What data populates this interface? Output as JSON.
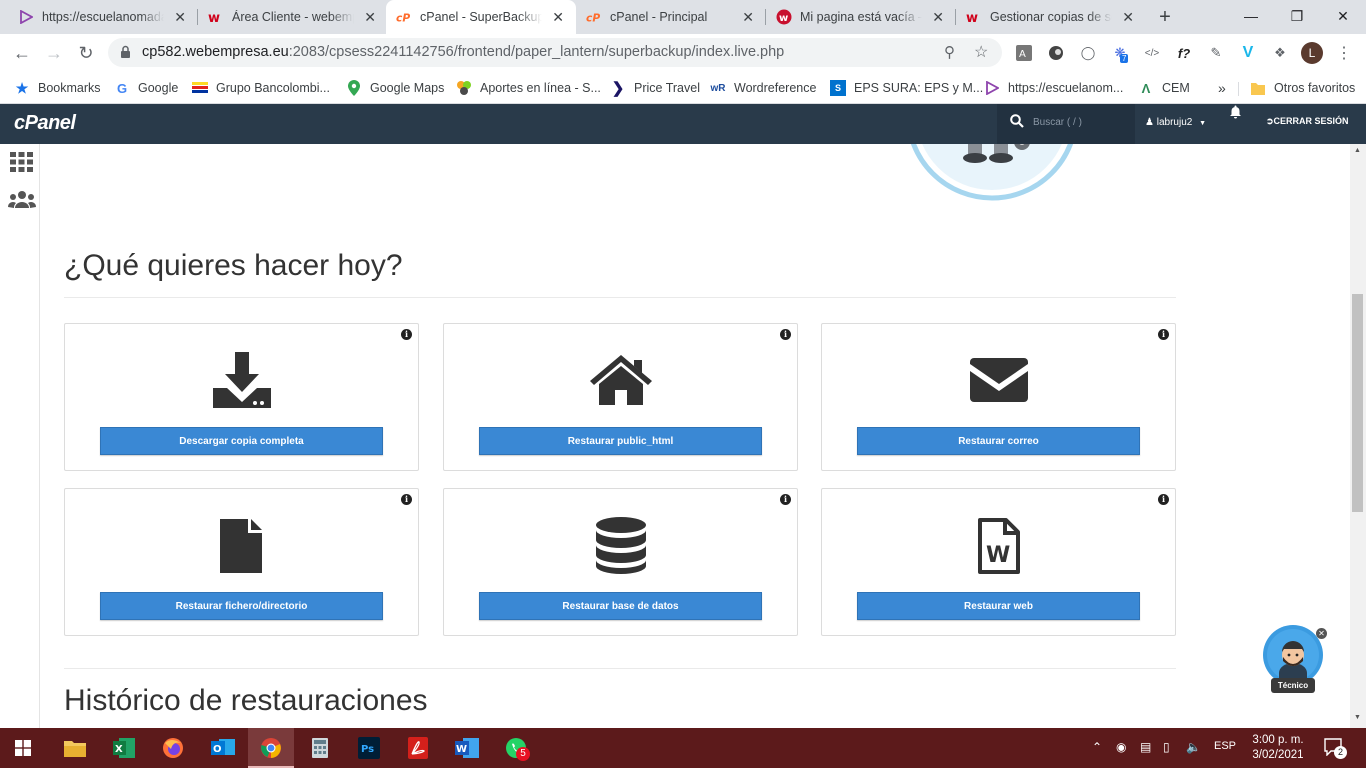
{
  "browser": {
    "tabs": [
      {
        "title": "https://escuelanomada...",
        "favicon": "play-triangle-icon",
        "active": false
      },
      {
        "title": "Área Cliente - webempresa",
        "favicon": "webempresa-icon",
        "active": false
      },
      {
        "title": "cPanel - SuperBackup",
        "favicon": "cpanel-icon",
        "active": true
      },
      {
        "title": "cPanel - Principal",
        "favicon": "cpanel-icon",
        "active": false
      },
      {
        "title": "Mi pagina está vacía – A",
        "favicon": "webempresa-icon",
        "active": false
      },
      {
        "title": "Gestionar copias de seguridad",
        "favicon": "webempresa-icon",
        "active": false
      }
    ],
    "new_tab_symbol": "+",
    "url_host": "cp582.webempresa.eu",
    "url_path": ":2083/cpsess2241142756/frontend/paper_lantern/superbackup/index.live.php",
    "profile_initial": "L",
    "extension_badge": "7",
    "bookmarks": [
      {
        "label": "Bookmarks",
        "icon": "star-icon"
      },
      {
        "label": "Google",
        "icon": "google-icon"
      },
      {
        "label": "Grupo Bancolombi...",
        "icon": "bancolombia-icon"
      },
      {
        "label": "Google Maps",
        "icon": "maps-pin-icon"
      },
      {
        "label": "Aportes en línea - S...",
        "icon": "aportes-icon"
      },
      {
        "label": "Price Travel",
        "icon": "pricetravel-icon"
      },
      {
        "label": "Wordreference",
        "icon": "wordreference-icon"
      },
      {
        "label": "EPS SURA: EPS y M...",
        "icon": "sura-icon"
      },
      {
        "label": "https://escuelanom...",
        "icon": "play-triangle-icon"
      },
      {
        "label": "CEM",
        "icon": "cem-icon"
      }
    ],
    "bookmarks_overflow": "»",
    "other_bookmarks": "Otros favoritos"
  },
  "cpanel": {
    "logo": "cPanel",
    "search_placeholder": "Buscar ( / )",
    "username": "labruju2",
    "logout_label": "CERRAR SESIÓN"
  },
  "main": {
    "heading": "¿Qué quieres hacer hoy?",
    "cards": [
      {
        "label": "Descargar copia completa",
        "icon": "download-icon"
      },
      {
        "label": "Restaurar public_html",
        "icon": "home-icon"
      },
      {
        "label": "Restaurar correo",
        "icon": "envelope-icon"
      },
      {
        "label": "Restaurar fichero/directorio",
        "icon": "file-icon"
      },
      {
        "label": "Restaurar base de datos",
        "icon": "database-icon"
      },
      {
        "label": "Restaurar web",
        "icon": "word-file-icon"
      }
    ],
    "info_glyph": "i",
    "history_heading": "Histórico de restauraciones"
  },
  "chat_widget": {
    "label": "Técnico"
  },
  "taskbar": {
    "language": "ESP",
    "time": "3:00 p. m.",
    "date": "3/02/2021",
    "notification_count": "2",
    "whatsapp_badge": "5",
    "apps": [
      "file-explorer-icon",
      "excel-icon",
      "firefox-icon",
      "outlook-icon",
      "chrome-icon",
      "calculator-icon",
      "photoshop-icon",
      "acrobat-icon",
      "word-icon",
      "whatsapp-icon"
    ]
  },
  "colors": {
    "cpanel_header": "#293a4a",
    "button_blue": "#3a88d4",
    "taskbar": "#5c1a1b"
  }
}
